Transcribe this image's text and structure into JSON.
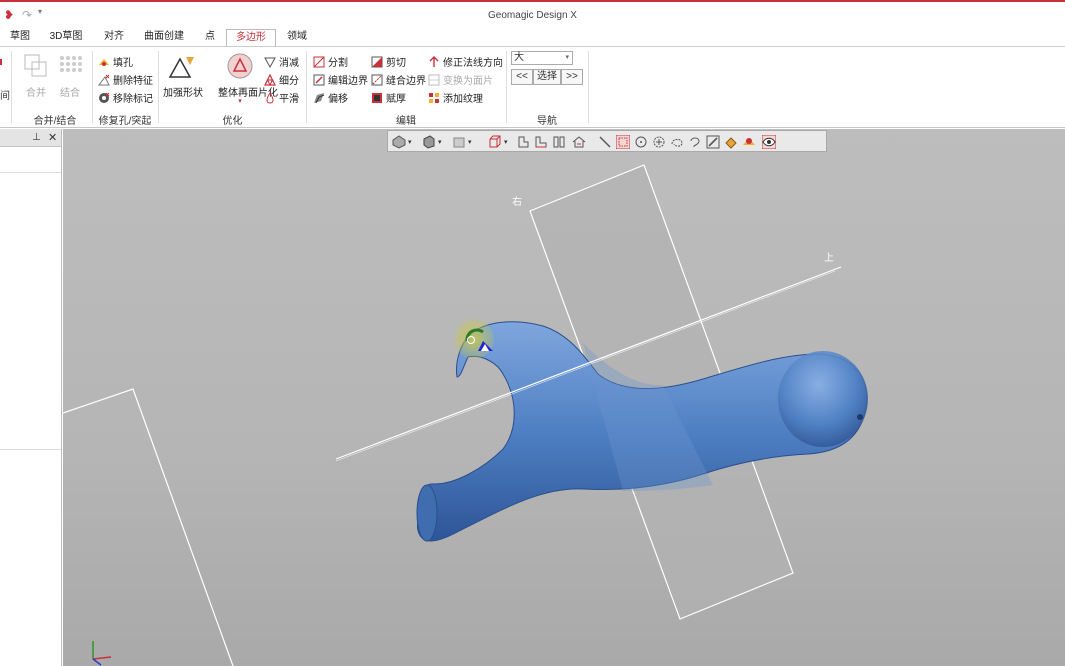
{
  "app": {
    "title": "Geomagic Design X"
  },
  "tabs": [
    {
      "label": "草图"
    },
    {
      "label": "3D草图"
    },
    {
      "label": "对齐"
    },
    {
      "label": "曲面创建"
    },
    {
      "label": "点"
    },
    {
      "label": "多边形",
      "active": true
    },
    {
      "label": "领域"
    }
  ],
  "ribbon": {
    "merge_group": {
      "label": "合并/结合",
      "merge": "合并",
      "combine": "结合",
      "partial": "间"
    },
    "repair_group": {
      "label": "修复孔/突起",
      "fill_hole": "填孔",
      "delete_feature": "删除特征",
      "remove_marker": "移除标记"
    },
    "optimize_group": {
      "label": "优化",
      "add_shape": "加强形状",
      "global_remesh": "整体再面片化",
      "decimate": "消减",
      "subdivide": "细分",
      "smooth": "平滑"
    },
    "edit_group": {
      "label": "编辑",
      "split": "分割",
      "edit_boundary": "编辑边界",
      "offset": "偏移",
      "trim": "剪切",
      "stitch_boundary": "缝合边界",
      "thicken": "赋厚",
      "fix_normal": "修正法线方向",
      "convert_to_surface": "变换为面片",
      "add_texture": "添加纹理"
    },
    "nav_group": {
      "label": "导航",
      "size_select": "大",
      "prev": "<<",
      "select": "选择",
      "next": ">>"
    }
  },
  "viewport": {
    "label_right": "右",
    "label_top": "上"
  },
  "colors": {
    "accent": "#c9303a",
    "mesh": "#4f80c4",
    "viewport_bg": "#b8b8b8"
  }
}
